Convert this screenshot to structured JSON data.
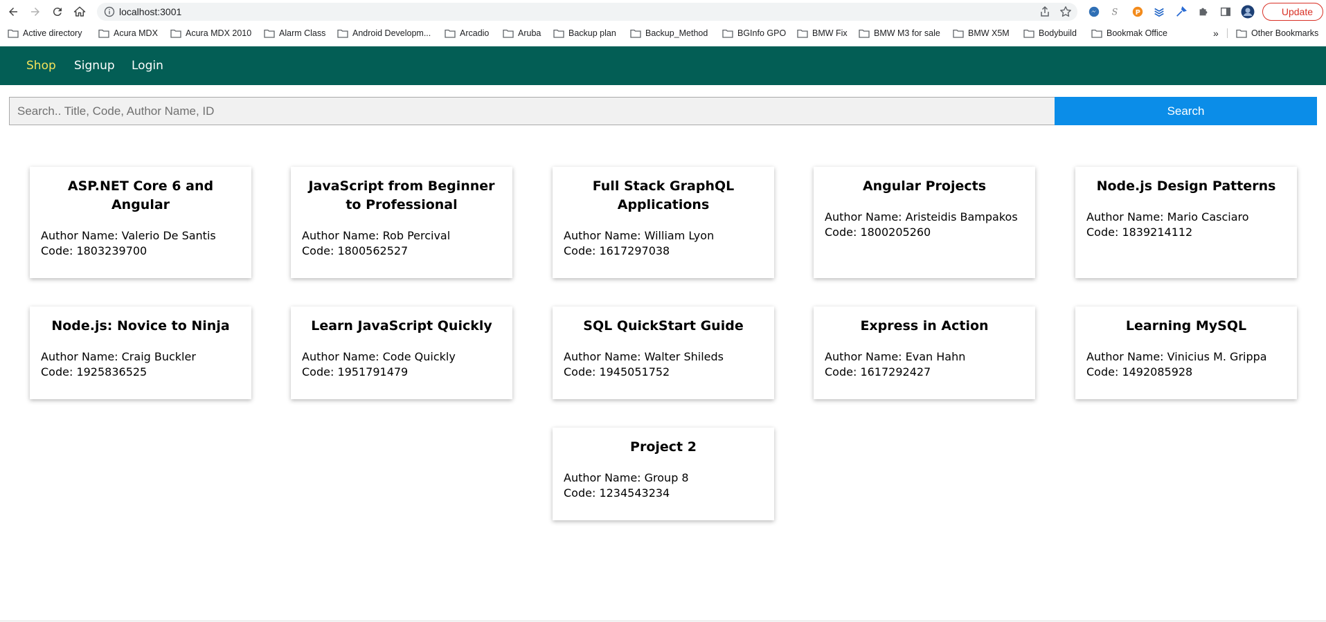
{
  "browser": {
    "url": "localhost:3001",
    "update_label": "Update",
    "bookmarks": [
      "Active directory",
      "Acura MDX",
      "Acura MDX 2010",
      "Alarm Class",
      "Android Developm...",
      "Arcadio",
      "Aruba",
      "Backup plan",
      "Backup_Method",
      "BGInfo GPO",
      "BMW Fix",
      "BMW M3 for sale",
      "BMW X5M",
      "Bodybuild",
      "Bookmak Office"
    ],
    "more_bookmarks": "»",
    "other_bookmarks": "Other Bookmarks"
  },
  "nav": {
    "shop": "Shop",
    "signup": "Signup",
    "login": "Login",
    "active_color": "#f4e35a",
    "bar_color": "#035e55"
  },
  "search": {
    "placeholder": "Search.. Title, Code, Author Name, ID",
    "value": "",
    "button_label": "Search",
    "button_color": "#0b8de8"
  },
  "books": [
    {
      "title": "ASP.NET Core 6 and Angular",
      "author": "Author Name: Valerio De Santis",
      "code": "Code: 1803239700"
    },
    {
      "title": "JavaScript from Beginner to Professional",
      "author": "Author Name: Rob Percival",
      "code": "Code: 1800562527"
    },
    {
      "title": "Full Stack GraphQL Applications",
      "author": "Author Name: William Lyon",
      "code": "Code: 1617297038"
    },
    {
      "title": "Angular Projects",
      "author": "Author Name: Aristeidis Bampakos",
      "code": "Code: 1800205260"
    },
    {
      "title": "Node.js Design Patterns",
      "author": "Author Name: Mario Casciaro",
      "code": "Code: 1839214112"
    },
    {
      "title": "Node.js: Novice to Ninja",
      "author": "Author Name: Craig Buckler",
      "code": "Code: 1925836525"
    },
    {
      "title": "Learn JavaScript Quickly",
      "author": "Author Name: Code Quickly",
      "code": "Code: 1951791479"
    },
    {
      "title": "SQL QuickStart Guide",
      "author": "Author Name: Walter Shileds",
      "code": "Code: 1945051752"
    },
    {
      "title": "Express in Action",
      "author": "Author Name: Evan Hahn",
      "code": "Code: 1617292427"
    },
    {
      "title": "Learning MySQL",
      "author": "Author Name: Vinicius M. Grippa",
      "code": "Code: 1492085928"
    },
    {
      "title": "Project 2",
      "author": "Author Name: Group 8",
      "code": "Code: 1234543234"
    }
  ]
}
